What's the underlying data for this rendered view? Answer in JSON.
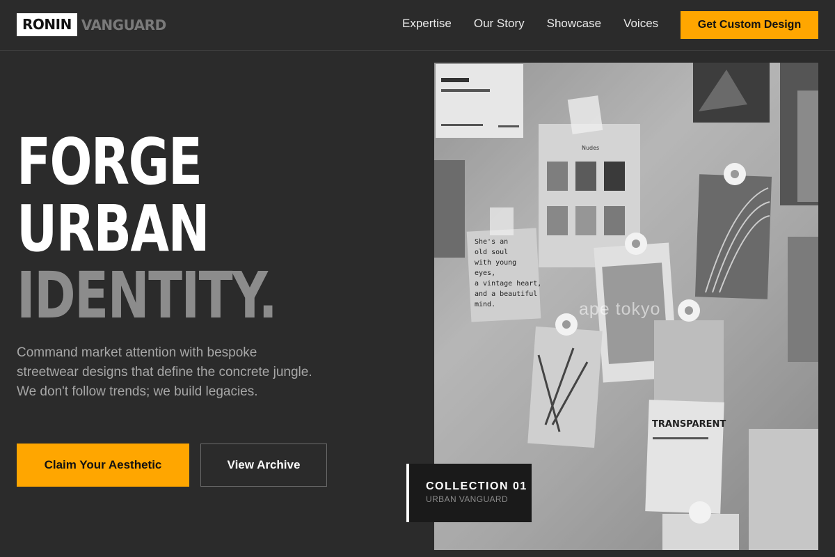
{
  "brand": {
    "logo_box": "RONIN",
    "logo_rest": "VANGUARD"
  },
  "nav": {
    "links": [
      "Expertise",
      "Our Story",
      "Showcase",
      "Voices"
    ],
    "cta": "Get Custom Design"
  },
  "hero": {
    "headline_line1": "FORGE",
    "headline_line2": "URBAN",
    "headline_line3": "IDENTITY.",
    "subcopy": "Command market attention with bespoke streetwear designs that define the concrete jungle. We don't follow trends; we build legacies.",
    "primary_cta": "Claim Your Aesthetic",
    "secondary_cta": "View Archive"
  },
  "photo": {
    "watermark": "ape tokyo",
    "card_nudes": "Nudes",
    "card_transparent": "TRANSPARENT",
    "note_text": [
      "She's an",
      "old soul",
      "with young",
      "eyes,",
      "a vintage heart,",
      "and a beautiful",
      "mind."
    ]
  },
  "collection": {
    "title": "COLLECTION 01",
    "subtitle": "URBAN VANGUARD"
  },
  "colors": {
    "accent": "#ffa600",
    "background": "#2b2b2b",
    "muted_text": "#a7a7a7"
  }
}
